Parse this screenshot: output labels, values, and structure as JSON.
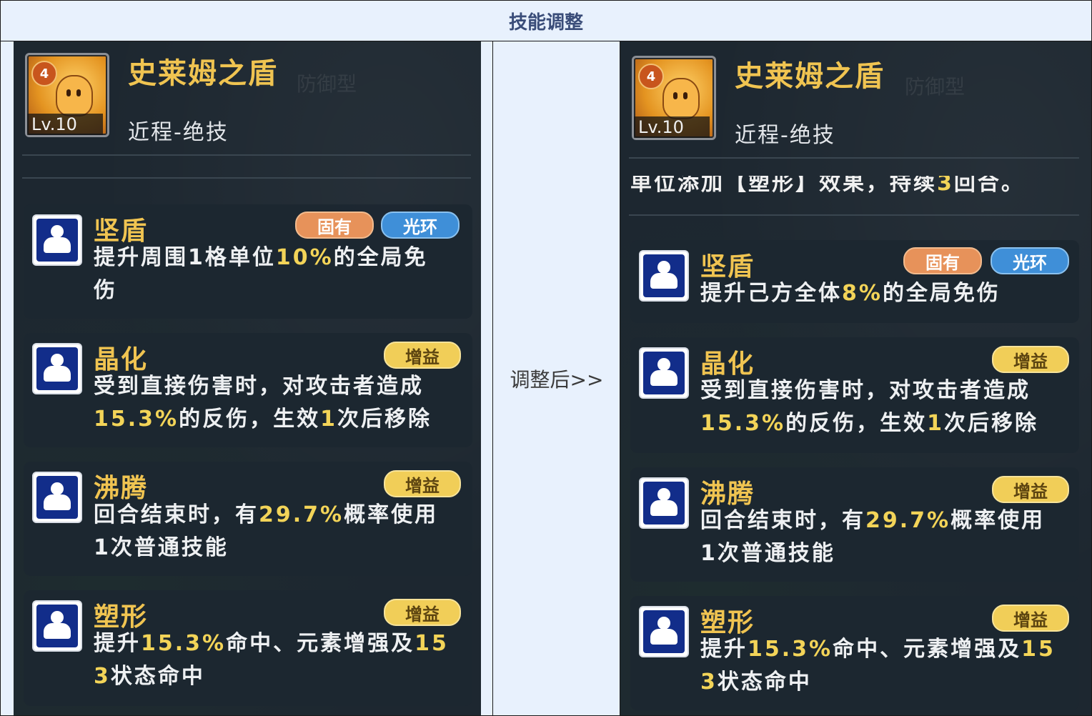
{
  "header": {
    "title": "技能调整"
  },
  "middle": {
    "label": "调整后>>"
  },
  "hero": {
    "name": "史莱姆之盾",
    "type": "近程-绝技",
    "star": "4",
    "level": "Lv.10",
    "ghost_text": "防御型"
  },
  "right_cut_text": {
    "part1": "单位添加【塑形】效果，持续",
    "num": "3",
    "part2": "回合。"
  },
  "left": {
    "skills": [
      {
        "name": "坚盾",
        "tags": [
          "固有",
          "光环"
        ],
        "line1": {
          "a": "提升周围1格单位",
          "hl": "10%",
          "b": "的全局免"
        },
        "line2": {
          "a": "伤",
          "hl": "",
          "b": ""
        }
      },
      {
        "name": "晶化",
        "tags": [
          "增益"
        ],
        "line1": {
          "a": "受到直接伤害时，对攻击者造成",
          "hl": "",
          "b": ""
        },
        "line2": {
          "a": "",
          "hl": "15.3%",
          "b": "的反伤，生效",
          "hl2": "1",
          "c": "次后移除"
        }
      },
      {
        "name": "沸腾",
        "tags": [
          "增益"
        ],
        "line1": {
          "a": "回合结束时，有",
          "hl": "29.7%",
          "b": "概率使用"
        },
        "line2": {
          "a": "1次普通技能",
          "hl": "",
          "b": ""
        }
      },
      {
        "name": "塑形",
        "tags": [
          "增益"
        ],
        "line1": {
          "a": "提升",
          "hl": "15.3%",
          "b": "命中、元素增强及",
          "hl2": "15"
        },
        "line2": {
          "a": "",
          "hl": "3",
          "b": "状态命中"
        }
      }
    ]
  },
  "right": {
    "skills": [
      {
        "name": "坚盾",
        "tags": [
          "固有",
          "光环"
        ],
        "line1": {
          "a": "提升己方全体",
          "hl": "8%",
          "b": "的全局免伤"
        }
      },
      {
        "name": "晶化",
        "tags": [
          "增益"
        ],
        "line1": {
          "a": "受到直接伤害时，对攻击者造成",
          "hl": "",
          "b": ""
        },
        "line2": {
          "a": "",
          "hl": "15.3%",
          "b": "的反伤，生效",
          "hl2": "1",
          "c": "次后移除"
        }
      },
      {
        "name": "沸腾",
        "tags": [
          "增益"
        ],
        "line1": {
          "a": "回合结束时，有",
          "hl": "29.7%",
          "b": "概率使用"
        },
        "line2": {
          "a": "1次普通技能",
          "hl": "",
          "b": ""
        }
      },
      {
        "name": "塑形",
        "tags": [
          "增益"
        ],
        "line1": {
          "a": "提升",
          "hl": "15.3%",
          "b": "命中、元素增强及",
          "hl2": "15"
        },
        "line2": {
          "a": "",
          "hl": "3",
          "b": "状态命中"
        }
      }
    ]
  }
}
